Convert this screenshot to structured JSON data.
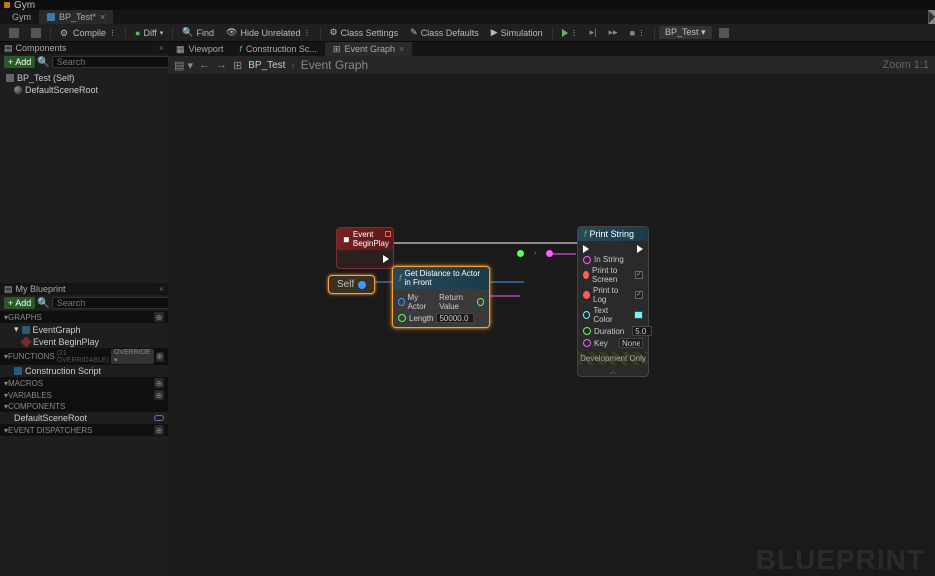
{
  "titlebar": {
    "title": "Gym"
  },
  "tabs": [
    {
      "label": "Gym",
      "active": false
    },
    {
      "label": "BP_Test*",
      "active": true
    }
  ],
  "toolbar": {
    "compile": "Compile",
    "diff": "Diff",
    "find": "Find",
    "hide_unrelated": "Hide Unrelated",
    "class_settings": "Class Settings",
    "class_defaults": "Class Defaults",
    "simulation": "Simulation",
    "debug_target": "BP_Test"
  },
  "components_panel": {
    "title": "Components",
    "add": "Add",
    "search_placeholder": "Search",
    "root": "BP_Test (Self)",
    "items": [
      "DefaultSceneRoot"
    ]
  },
  "myblueprint": {
    "title": "My Blueprint",
    "add": "Add",
    "search_placeholder": "Search",
    "sections": {
      "graphs": "Graphs",
      "functions": "Functions",
      "functions_suffix": "(21 Overridable)",
      "macros": "Macros",
      "variables": "Variables",
      "components": "Components",
      "event_dispatchers": "Event Dispatchers"
    },
    "graphs": {
      "eventgraph": "EventGraph",
      "beginplay": "Event BeginPlay"
    },
    "functions": {
      "override": "Override",
      "construction": "Construction Script"
    },
    "components": {
      "default_scene_root": "DefaultSceneRoot"
    }
  },
  "graph_tabs": [
    {
      "label": "Viewport"
    },
    {
      "label": "Construction Sc..."
    },
    {
      "label": "Event Graph",
      "active": true
    }
  ],
  "breadcrumb": {
    "root": "BP_Test",
    "current": "Event Graph",
    "zoom": "Zoom 1:1"
  },
  "nodes": {
    "beginplay": {
      "title": "Event BeginPlay"
    },
    "self": {
      "label": "Self"
    },
    "getdist": {
      "title": "Get Distance to Actor in Front",
      "my_actor": "My Actor",
      "return": "Return Value",
      "length": "Length",
      "length_val": "50000.0"
    },
    "printstring": {
      "title": "Print String",
      "in_string": "In String",
      "print_screen": "Print to Screen",
      "print_log": "Print to Log",
      "text_color": "Text Color",
      "duration": "Duration",
      "duration_val": "5.0",
      "key": "Key",
      "key_val": "None",
      "dev_only": "Development Only"
    }
  },
  "watermark": "BLUEPRINT"
}
